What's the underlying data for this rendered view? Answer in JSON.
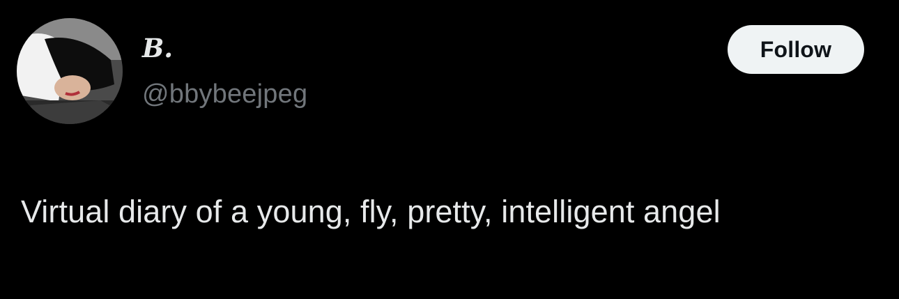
{
  "profile": {
    "display_name": "B.",
    "handle": "@bbybeejpeg",
    "avatar_icon": "profile-photo",
    "follow_label": "Follow",
    "bio": "Virtual diary of a young, fly, pretty, intelligent angel"
  },
  "colors": {
    "background": "#000000",
    "primary_text": "#e7e9ea",
    "secondary_text": "#71767b",
    "button_bg": "#eff3f4",
    "button_text": "#0f1419"
  }
}
